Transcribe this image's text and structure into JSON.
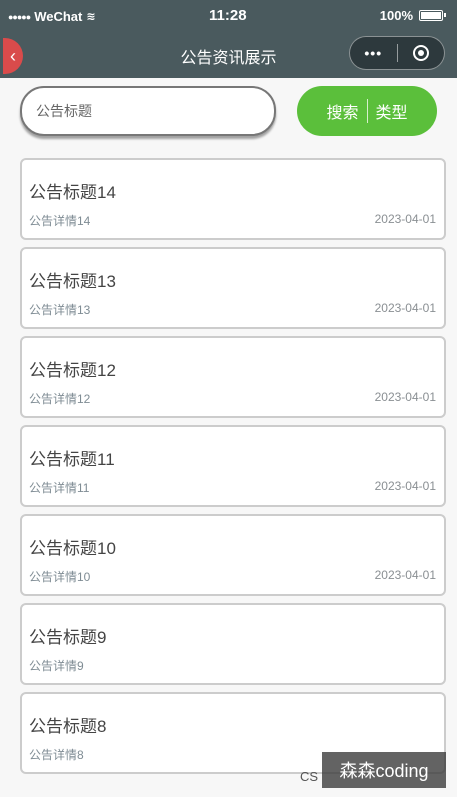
{
  "status_bar": {
    "signal": "●●●●●",
    "carrier": "WeChat",
    "wifi_icon": "wifi-icon",
    "time": "11:28",
    "battery_percent": "100%",
    "battery_icon": "battery-icon"
  },
  "nav": {
    "title": "公告资讯展示",
    "back_icon": "back-icon",
    "more_icon": "•••",
    "close_icon": "close-circle-icon"
  },
  "search": {
    "placeholder": "公告标题",
    "search_label": "搜索",
    "type_label": "类型"
  },
  "list": {
    "items": [
      {
        "title": "公告标题14",
        "detail": "公告详情14",
        "date": "2023-04-01"
      },
      {
        "title": "公告标题13",
        "detail": "公告详情13",
        "date": "2023-04-01"
      },
      {
        "title": "公告标题12",
        "detail": "公告详情12",
        "date": "2023-04-01"
      },
      {
        "title": "公告标题11",
        "detail": "公告详情11",
        "date": "2023-04-01"
      },
      {
        "title": "公告标题10",
        "detail": "公告详情10",
        "date": "2023-04-01"
      },
      {
        "title": "公告标题9",
        "detail": "公告详情9",
        "date": ""
      },
      {
        "title": "公告标题8",
        "detail": "公告详情8",
        "date": ""
      }
    ]
  },
  "watermark": {
    "prefix": "CS",
    "text": "森森coding"
  },
  "colors": {
    "nav_background": "#4a5a5e",
    "accent_green": "#5bbf3b",
    "back_button": "#d94b4b"
  }
}
